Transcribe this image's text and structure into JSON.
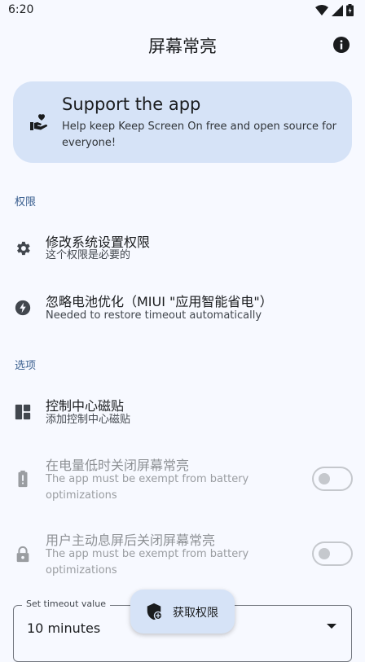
{
  "status_bar": {
    "time": "6:20",
    "icons": [
      "wifi-icon",
      "signal-icon",
      "battery-icon"
    ]
  },
  "app_bar": {
    "title": "屏幕常亮",
    "info_icon": "info-icon"
  },
  "support_card": {
    "title": "Support the app",
    "description": "Help keep Keep Screen On free and open source for everyone!",
    "icon": "heart-hand-icon"
  },
  "sections": {
    "permissions": "权限",
    "options": "选项"
  },
  "permissions": [
    {
      "title": "修改系统设置权限",
      "subtitle": "这个权限是必要的",
      "icon": "gear-icon"
    },
    {
      "title": "忽略电池优化（MIUI \"应用智能省电\"）",
      "subtitle": "Needed to restore timeout automatically",
      "icon": "battery-saver-icon"
    }
  ],
  "options": [
    {
      "title": "控制中心磁贴",
      "subtitle": "添加控制中心磁贴",
      "icon": "tile-icon",
      "enabled": true
    },
    {
      "title": "在电量低时关闭屏幕常亮",
      "subtitle": "The app must be exempt from battery optimizations",
      "icon": "battery-alert-icon",
      "enabled": false,
      "switch_on": false
    },
    {
      "title": "用户主动息屏后关闭屏幕常亮",
      "subtitle": "The app must be exempt from battery optimizations",
      "icon": "lock-icon",
      "enabled": false,
      "switch_on": false
    }
  ],
  "timeout": {
    "label": "Set timeout value",
    "value": "10 minutes"
  },
  "fab": {
    "label": "获取权限",
    "icon": "shield-add-icon"
  },
  "colors": {
    "background": "#f7f9ff",
    "card": "#d6e3f7",
    "section_title": "#3b6090"
  }
}
